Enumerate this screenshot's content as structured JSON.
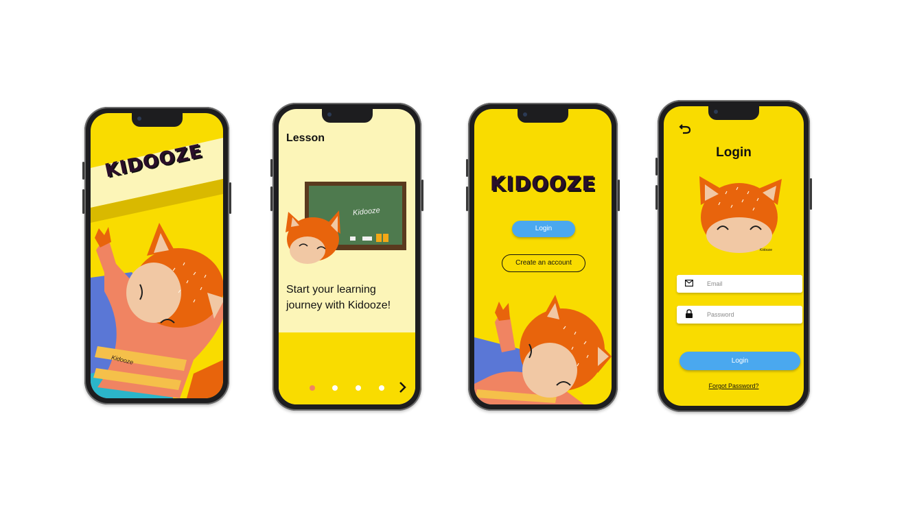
{
  "screens": {
    "splash": {
      "logo": "KIDOOZE",
      "sweater_text": "Kidooze"
    },
    "lesson": {
      "title": "Lesson",
      "chalkboard_text": "Kidooze",
      "headline": "Start your learning journey with Kidooze!",
      "pagination": {
        "total": 4,
        "active_index": 0
      },
      "next_icon": "chevron-right-icon"
    },
    "welcome": {
      "logo": "KIDOOZE",
      "login_label": "Login",
      "create_account_label": "Create an account"
    },
    "login": {
      "back_icon": "undo-arrow-icon",
      "title": "Login",
      "fox_signature": "Kidooze",
      "email_placeholder": "Email",
      "email_icon": "mail-icon",
      "password_placeholder": "Password",
      "password_icon": "lock-icon",
      "login_label": "Login",
      "forgot_label": "Forgot Password?"
    }
  },
  "colors": {
    "yellow": "#f9dc00",
    "pale_yellow": "#fcf5b8",
    "blue_button": "#4aa8ef",
    "fox_orange": "#e8640c",
    "fox_cream": "#f1c8a4",
    "sweater": "#f08462",
    "chalkboard": "#4e7a4e"
  }
}
